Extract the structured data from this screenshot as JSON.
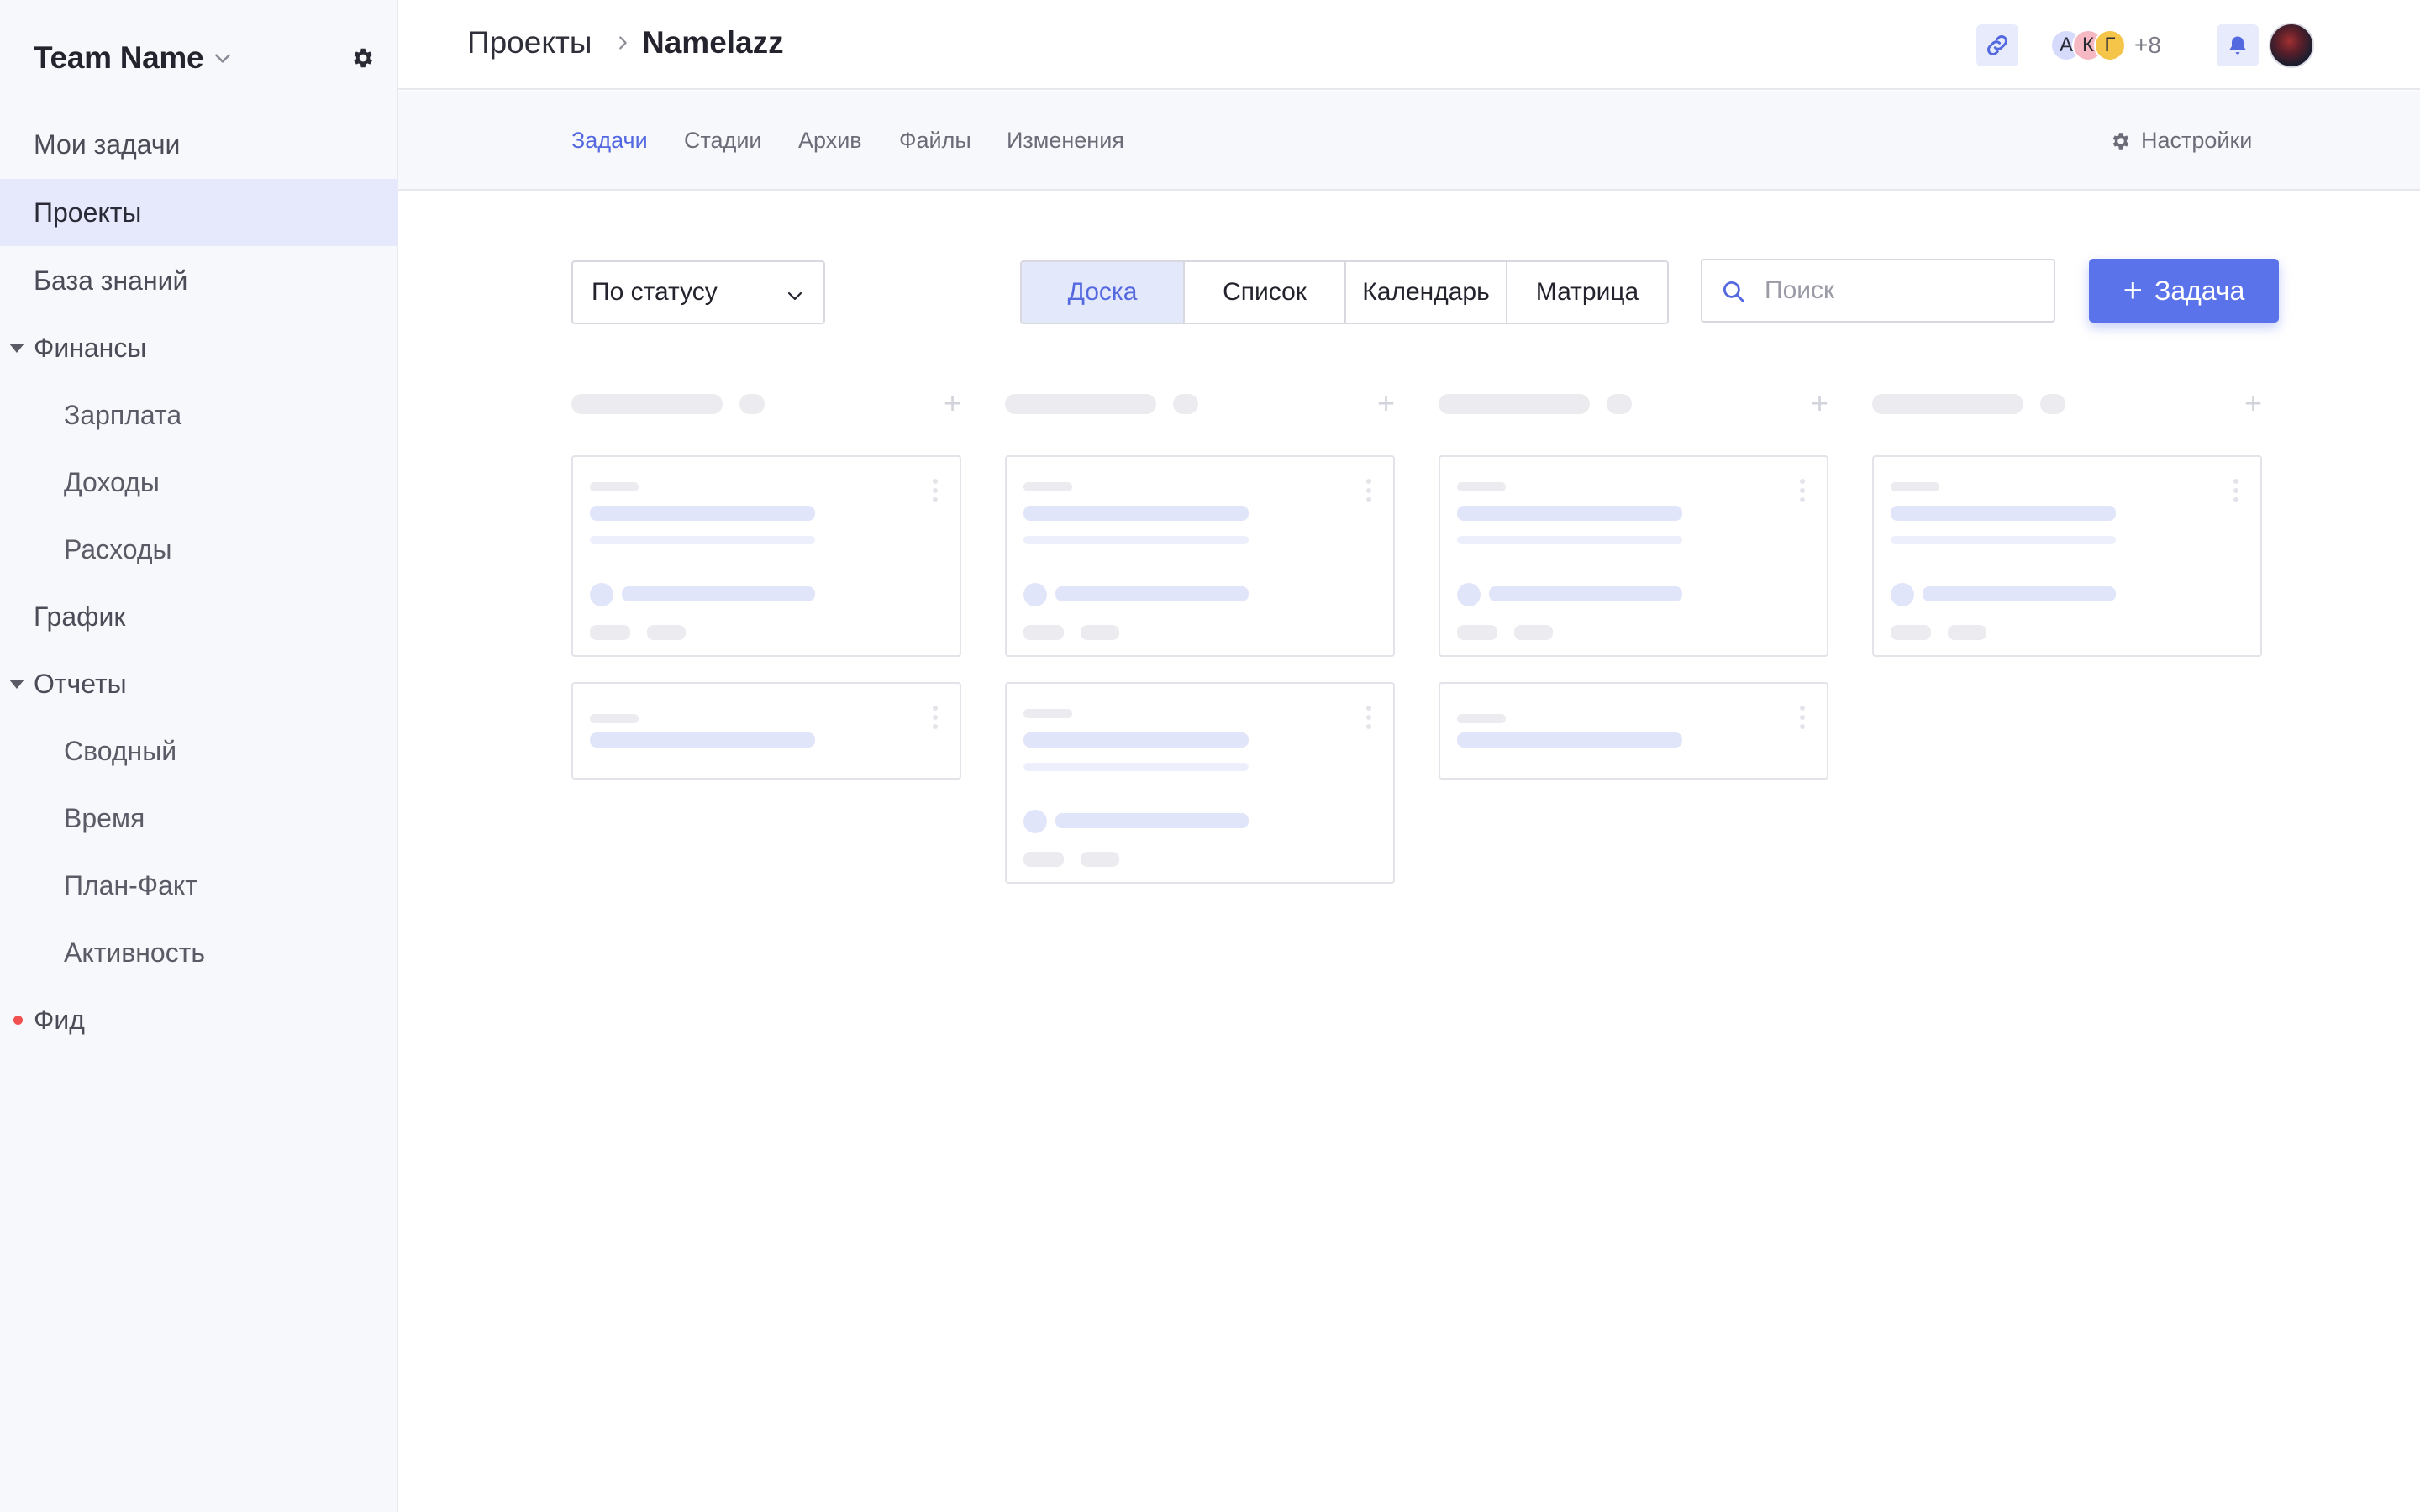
{
  "sidebar": {
    "team_name": "Team Name",
    "items": [
      {
        "label": "Мои задачи"
      },
      {
        "label": "Проекты"
      },
      {
        "label": "База знаний"
      },
      {
        "label": "Финансы"
      },
      {
        "label": "Зарплата"
      },
      {
        "label": "Доходы"
      },
      {
        "label": "Расходы"
      },
      {
        "label": "График"
      },
      {
        "label": "Отчеты"
      },
      {
        "label": "Сводный"
      },
      {
        "label": "Время"
      },
      {
        "label": "План-Факт"
      },
      {
        "label": "Активность"
      },
      {
        "label": "Фид"
      }
    ]
  },
  "header": {
    "breadcrumb_root": "Проекты",
    "breadcrumb_current": "Namelazz",
    "avatars": [
      "А",
      "К",
      "Г"
    ],
    "avatar_colors": [
      "#d6dbfb",
      "#f6b8c3",
      "#f5c54a"
    ],
    "members_more": "+8"
  },
  "tabs": [
    "Задачи",
    "Стадии",
    "Архив",
    "Файлы",
    "Изменения"
  ],
  "settings_label": "Настройки",
  "toolbar": {
    "group_by": "По статусу",
    "views": [
      "Доска",
      "Список",
      "Календарь",
      "Матрица"
    ],
    "active_view": "Доска",
    "search_placeholder": "Поиск",
    "add_task_label": "Задача"
  },
  "colors": {
    "accent": "#5b73ea",
    "active_nav_bg": "#e6e9fb",
    "feed_dot": "#f0504f"
  }
}
